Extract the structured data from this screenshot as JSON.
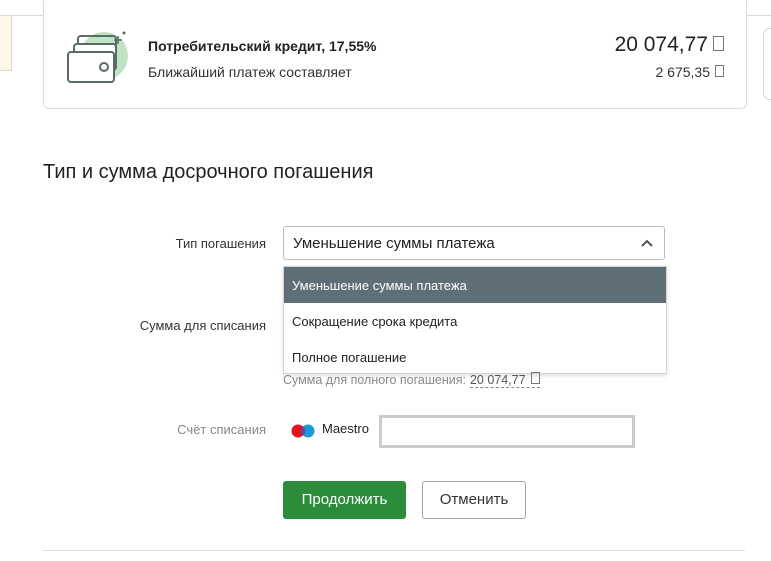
{
  "card": {
    "title": "Потребительский кредит, 17,55%",
    "subtitle": "Ближайший платеж составляет",
    "balance": "20 074,77",
    "next_payment": "2 675,35",
    "icon": "wallet-cards-icon"
  },
  "section": {
    "title": "Тип и сумма досрочного погашения"
  },
  "form": {
    "type_label": "Тип погашения",
    "type_selected": "Уменьшение суммы платежа",
    "options": [
      "Уменьшение суммы платежа",
      "Сокращение срока кредита",
      "Полное погашение"
    ],
    "sum_label": "Сумма для списания",
    "full_sum_text": "Сумма для полного погашения:",
    "full_sum_value": "20 074,77",
    "account_label": "Счёт списания",
    "card_brand": "Maestro",
    "continue_label": "Продолжить",
    "cancel_label": "Отменить"
  },
  "colors": {
    "primary_button": "#2b8c3a",
    "selected_option": "#5f6f78",
    "icon_accent": "#8fc89a"
  }
}
